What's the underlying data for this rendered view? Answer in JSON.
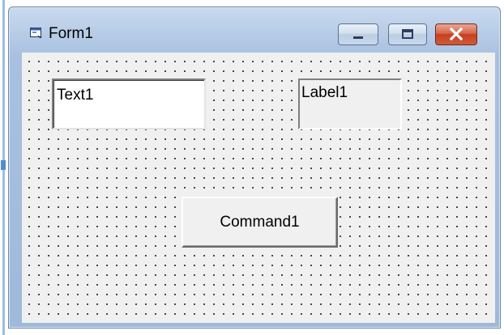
{
  "window": {
    "title": "Form1",
    "icon": "form-icon",
    "controls": {
      "minimize_icon": "minimize-icon",
      "maximize_icon": "maximize-icon",
      "close_icon": "close-icon"
    }
  },
  "form": {
    "textbox_value": "Text1",
    "label_caption": "Label1",
    "command_caption": "Command1"
  },
  "colors": {
    "close_button": "#c6401f",
    "titlebar": "#b8cde7",
    "form_background": "#f0f0f0"
  }
}
